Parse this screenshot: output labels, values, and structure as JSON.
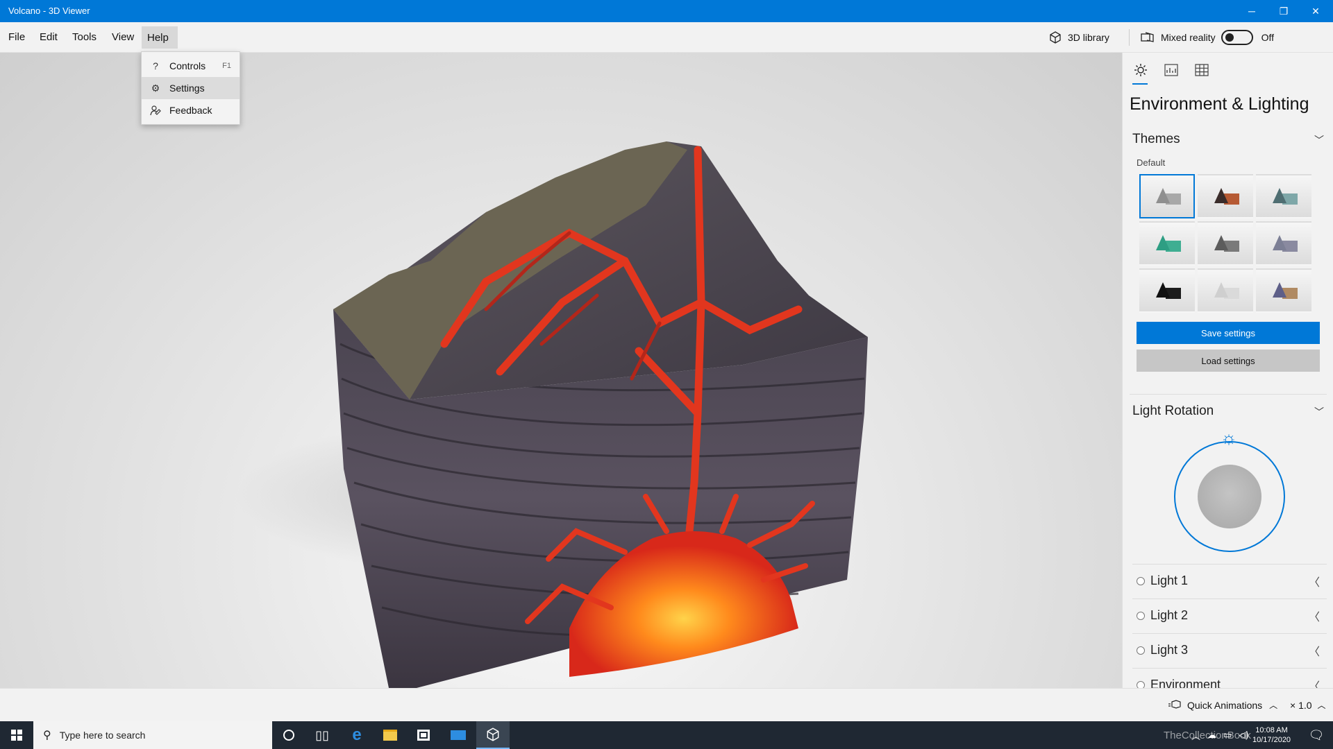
{
  "window": {
    "title": "Volcano - 3D Viewer",
    "controls": {
      "minimize": "─",
      "restore": "❐",
      "close": "✕"
    }
  },
  "menubar": {
    "items": [
      {
        "label": "File"
      },
      {
        "label": "Edit"
      },
      {
        "label": "Tools"
      },
      {
        "label": "View"
      },
      {
        "label": "Help",
        "active": true
      }
    ],
    "library_label": "3D library",
    "mixed_reality_label": "Mixed reality",
    "mixed_reality_state": "Off"
  },
  "help_menu": {
    "items": [
      {
        "label": "Controls",
        "shortcut": "F1",
        "icon": "question-icon"
      },
      {
        "label": "Settings",
        "shortcut": "",
        "icon": "gear-icon"
      },
      {
        "label": "Feedback",
        "shortcut": "",
        "icon": "feedback-icon"
      }
    ]
  },
  "panel": {
    "tabs": [
      {
        "name": "environment-lighting-tab",
        "icon": "sun-icon",
        "active": true
      },
      {
        "name": "stats-shading-tab",
        "icon": "stats-icon",
        "active": false
      },
      {
        "name": "grid-views-tab",
        "icon": "grid-icon",
        "active": false
      }
    ],
    "title": "Environment & Lighting",
    "themes": {
      "heading": "Themes",
      "subheading": "Default",
      "swatches": [
        {
          "cone": "#8f8f8f",
          "box": "#a8a8a8",
          "selected": true
        },
        {
          "cone": "#3a2c2a",
          "box": "#b65a34",
          "selected": false
        },
        {
          "cone": "#4f6e72",
          "box": "#7ea7a8",
          "selected": false
        },
        {
          "cone": "#2e9e83",
          "box": "#3fae92",
          "selected": false
        },
        {
          "cone": "#5c5c5c",
          "box": "#7a7a7a",
          "selected": false
        },
        {
          "cone": "#7c7f95",
          "box": "#8a8aa0",
          "selected": false
        },
        {
          "cone": "#111111",
          "box": "#1c1c1c",
          "selected": false
        },
        {
          "cone": "#cfcfcf",
          "box": "#dadada",
          "selected": false
        },
        {
          "cone": "#5e5f88",
          "box": "#b08a62",
          "selected": false
        }
      ],
      "save_label": "Save settings",
      "load_label": "Load settings"
    },
    "light_rotation": {
      "heading": "Light Rotation",
      "lights": [
        "Light 1",
        "Light 2",
        "Light 3",
        "Environment"
      ]
    }
  },
  "statusbar": {
    "quick_animations": "Quick Animations",
    "speed": "× 1.0"
  },
  "taskbar": {
    "search_placeholder": "Type here to search",
    "time": "10:08 AM",
    "date": "10/17/2020",
    "watermark": "TheCollectionBook"
  },
  "colors": {
    "accent": "#0078d7",
    "titlebar": "#0078d7",
    "taskbar": "#1f2833"
  }
}
